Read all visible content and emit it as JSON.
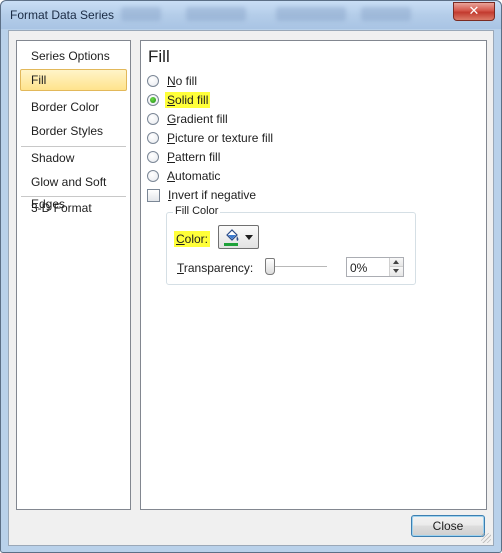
{
  "window": {
    "title": "Format Data Series",
    "close_glyph": "✕"
  },
  "nav": {
    "items": [
      {
        "label": "Series Options"
      },
      {
        "label": "Fill"
      },
      {
        "label": "Border Color"
      },
      {
        "label": "Border Styles"
      },
      {
        "label": "Shadow"
      },
      {
        "label": "Glow and Soft Edges"
      },
      {
        "label": "3-D Format"
      }
    ],
    "selected": "Fill"
  },
  "panel": {
    "title": "Fill",
    "options": [
      {
        "access_key": "N",
        "rest": "o fill",
        "type": "radio",
        "checked": false
      },
      {
        "access_key": "S",
        "rest": "olid fill",
        "type": "radio",
        "checked": true
      },
      {
        "access_key": "G",
        "rest": "radient fill",
        "type": "radio",
        "checked": false
      },
      {
        "access_key": "P",
        "rest": "icture or texture fill",
        "type": "radio",
        "checked": false
      },
      {
        "access_key": "P",
        "rest": "attern fill",
        "type": "radio",
        "checked": false
      },
      {
        "access_key": "A",
        "rest": "utomatic",
        "type": "radio",
        "checked": false
      },
      {
        "access_key": "I",
        "rest": "nvert if negative",
        "type": "checkbox",
        "checked": false
      }
    ],
    "fill_color": {
      "group_title": "Fill Color",
      "color_access_key": "C",
      "color_rest": "olor:",
      "color_value": "#1fa23a",
      "transparency_access_key": "T",
      "transparency_rest": "ransparency:",
      "transparency_percent": 0,
      "transparency_value": "0%"
    }
  },
  "footer": {
    "close_label": "Close"
  },
  "colors": {
    "highlight": "#ffff3a",
    "selected_nav": "#ffe38c",
    "title_bar": "#b4cde9"
  }
}
